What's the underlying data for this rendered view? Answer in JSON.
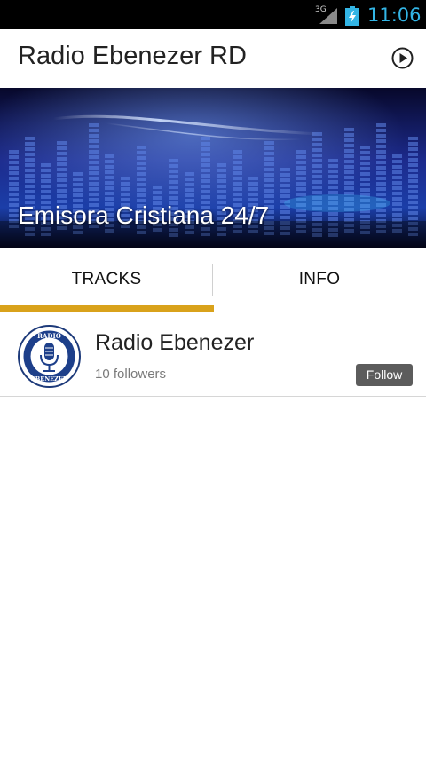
{
  "status_bar": {
    "network": "3G",
    "time": "11:06",
    "accent_color": "#33b5e5"
  },
  "app_bar": {
    "title": "Radio Ebenezer RD",
    "play_icon": "play-circle-icon"
  },
  "hero": {
    "caption": "Emisora Cristiana 24/7"
  },
  "tabs": {
    "items": [
      {
        "label": "TRACKS",
        "selected": true
      },
      {
        "label": "INFO",
        "selected": false
      }
    ],
    "indicator_color": "#d9a21b"
  },
  "profile": {
    "name": "Radio Ebenezer",
    "followers": "10 followers",
    "follow_label": "Follow",
    "avatar_text_top": "RADIO",
    "avatar_text_bottom": "EBENEZER"
  }
}
